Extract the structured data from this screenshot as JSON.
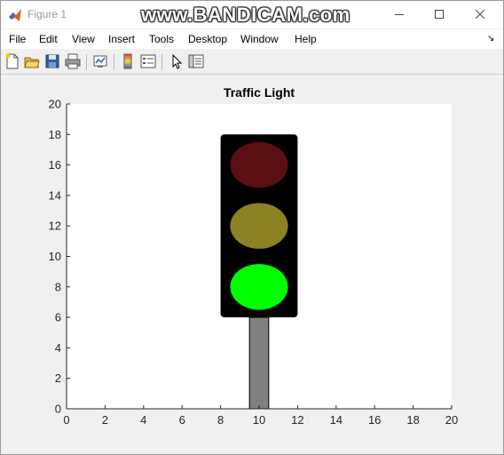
{
  "window": {
    "title": "Figure 1",
    "watermark": "www.BANDICAM.com"
  },
  "menu": [
    "File",
    "Edit",
    "View",
    "Insert",
    "Tools",
    "Desktop",
    "Window",
    "Help"
  ],
  "toolbar": {
    "icons": [
      "new-figure-icon",
      "open-file-icon",
      "save-icon",
      "print-icon",
      "link-plot-icon",
      "insert-colorbar-icon",
      "insert-legend-icon",
      "edit-plot-arrow-icon",
      "property-inspector-icon"
    ]
  },
  "chart_data": {
    "type": "diagram",
    "title": "Traffic Light",
    "xlim": [
      0,
      20
    ],
    "ylim": [
      0,
      20
    ],
    "xticks": [
      0,
      2,
      4,
      6,
      8,
      10,
      12,
      14,
      16,
      18,
      20
    ],
    "yticks": [
      0,
      2,
      4,
      6,
      8,
      10,
      12,
      14,
      16,
      18,
      20
    ],
    "pole": {
      "x": [
        9.5,
        10.5
      ],
      "y": [
        0,
        6
      ],
      "color": "#808080"
    },
    "housing": {
      "x": [
        8,
        12
      ],
      "y": [
        6,
        18
      ],
      "color": "#000000"
    },
    "lights": [
      {
        "name": "red",
        "cx": 10,
        "cy": 16,
        "rx": 1.5,
        "ry": 1.5,
        "color": "#5a1010"
      },
      {
        "name": "yellow",
        "cx": 10,
        "cy": 12,
        "rx": 1.5,
        "ry": 1.5,
        "color": "#8c8224"
      },
      {
        "name": "green",
        "cx": 10,
        "cy": 8,
        "rx": 1.5,
        "ry": 1.5,
        "color": "#00ff00"
      }
    ]
  }
}
